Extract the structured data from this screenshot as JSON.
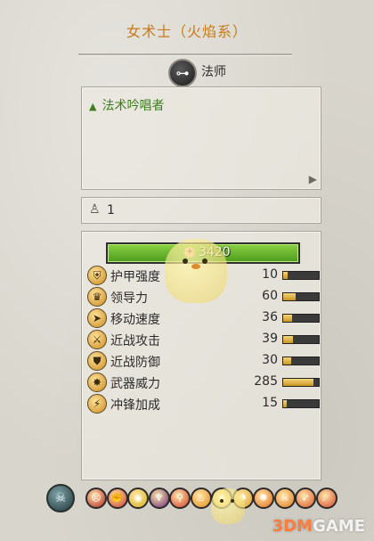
{
  "header": {
    "title": "女术士（火焰系）"
  },
  "unit_class": {
    "icon": "mage-eye-icon",
    "label": "法师"
  },
  "description": {
    "trait": "法术吟唱者"
  },
  "unit_count": {
    "value": "1"
  },
  "cost": {
    "value": "3420"
  },
  "stats": [
    {
      "name": "护甲强度",
      "value": "10",
      "fill": 0.12,
      "icon": "armor-icon"
    },
    {
      "name": "领导力",
      "value": "60",
      "fill": 0.35,
      "icon": "leadership-icon"
    },
    {
      "name": "移动速度",
      "value": "36",
      "fill": 0.25,
      "icon": "speed-icon"
    },
    {
      "name": "近战攻击",
      "value": "39",
      "fill": 0.28,
      "icon": "melee-attack-icon"
    },
    {
      "name": "近战防御",
      "value": "30",
      "fill": 0.22,
      "icon": "melee-defense-icon"
    },
    {
      "name": "武器威力",
      "value": "285",
      "fill": 0.85,
      "icon": "weapon-strength-icon"
    },
    {
      "name": "冲锋加成",
      "value": "15",
      "fill": 0.1,
      "icon": "charge-bonus-icon"
    }
  ],
  "abilities": {
    "main_icon": "skull-ability-icon",
    "items": [
      {
        "icon": "red-face-icon",
        "color": "#b42323"
      },
      {
        "icon": "fist-icon",
        "color": "#cc3b2b"
      },
      {
        "icon": "eye-icon",
        "color": "#d7b21f"
      },
      {
        "icon": "purple-mask-icon",
        "color": "#6a2a7c"
      },
      {
        "icon": "wand-icon",
        "color": "#d43a2a"
      },
      {
        "icon": "flame-icon",
        "color": "#e38b1a"
      },
      {
        "icon": "fire-orb-icon",
        "color": "#e0a21c"
      },
      {
        "icon": "fire-orb-icon",
        "color": "#dba12a"
      },
      {
        "icon": "fire-blast-icon",
        "color": "#e26c1c"
      },
      {
        "icon": "fire-skull-icon",
        "color": "#e07b1e"
      },
      {
        "icon": "fire-arrow-icon",
        "color": "#d9542a"
      },
      {
        "icon": "fire-rain-icon",
        "color": "#d4472a"
      }
    ]
  },
  "watermark": {
    "brand_3d": "3DM",
    "brand_game": "GAME"
  }
}
